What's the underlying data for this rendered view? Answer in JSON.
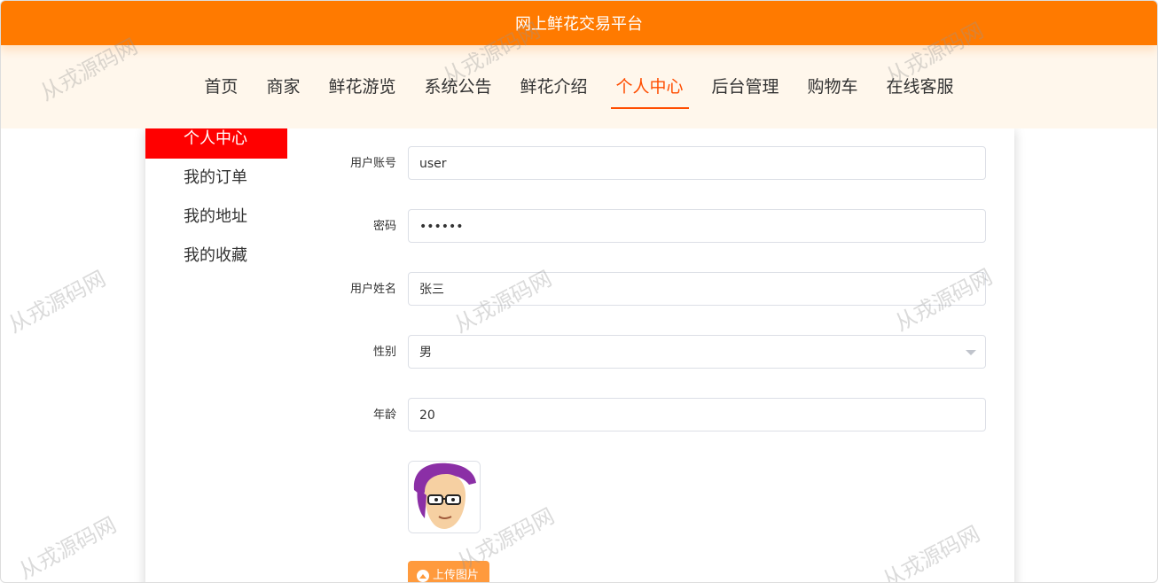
{
  "app": {
    "title": "网上鲜花交易平台"
  },
  "nav": {
    "items": [
      "首页",
      "商家",
      "鲜花游览",
      "系统公告",
      "鲜花介绍",
      "个人中心",
      "后台管理",
      "购物车",
      "在线客服"
    ],
    "active": "个人中心"
  },
  "sidebar": {
    "items": [
      "个人中心",
      "我的订单",
      "我的地址",
      "我的收藏"
    ],
    "active": "个人中心"
  },
  "form": {
    "fields": [
      {
        "label": "用户账号",
        "value": "user"
      },
      {
        "label": "密码",
        "value": "••••••"
      },
      {
        "label": "用户姓名",
        "value": "张三"
      },
      {
        "label": "性别",
        "value": "男"
      },
      {
        "label": "年龄",
        "value": "20"
      }
    ],
    "upload_label": "上传图片"
  },
  "watermark": {
    "text": "从戎源码网"
  },
  "icons": {
    "avatar": "avatar-image",
    "upload": "upload-icon",
    "select": "chevron-down-icon"
  },
  "colors": {
    "accent": "#ff7a00",
    "nav_bg": "#fff7ec",
    "sidebar_active": "#ff0000",
    "link_active": "#ff4d00",
    "upload": "#ff9a3d"
  }
}
